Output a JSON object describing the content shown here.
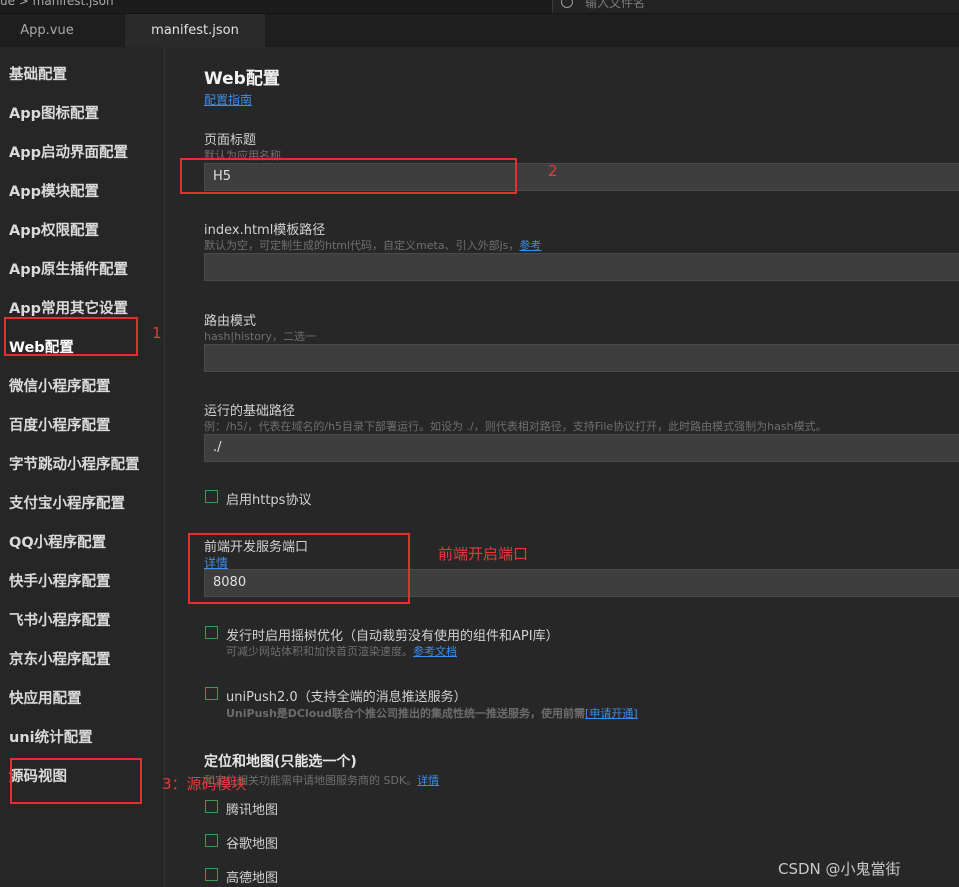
{
  "topbar": {
    "breadcrumb": "ue > manifest.json",
    "search_placeholder": "输入文件名"
  },
  "tabs": [
    {
      "label": "App.vue"
    },
    {
      "label": "manifest.json"
    }
  ],
  "sidebar": {
    "items": [
      {
        "label": "基础配置"
      },
      {
        "label": "App图标配置"
      },
      {
        "label": "App启动界面配置"
      },
      {
        "label": "App模块配置"
      },
      {
        "label": "App权限配置"
      },
      {
        "label": "App原生插件配置"
      },
      {
        "label": "App常用其它设置"
      },
      {
        "label": "Web配置"
      },
      {
        "label": "微信小程序配置"
      },
      {
        "label": "百度小程序配置"
      },
      {
        "label": "字节跳动小程序配置"
      },
      {
        "label": "支付宝小程序配置"
      },
      {
        "label": "QQ小程序配置"
      },
      {
        "label": "快手小程序配置"
      },
      {
        "label": "飞书小程序配置"
      },
      {
        "label": "京东小程序配置"
      },
      {
        "label": "快应用配置"
      },
      {
        "label": "uni统计配置"
      },
      {
        "label": "源码视图"
      }
    ]
  },
  "main": {
    "title": "Web配置",
    "guide_link": "配置指南",
    "page_title": {
      "label": "页面标题",
      "hint": "默认为应用名称",
      "value": "H5"
    },
    "template_path": {
      "label": "index.html模板路径",
      "hint": "默认为空，可定制生成的html代码，自定义meta、引入外部js，",
      "hint_link": "参考",
      "value": ""
    },
    "router_mode": {
      "label": "路由模式",
      "hint": "hash|history，二选一",
      "value": ""
    },
    "base_path": {
      "label": "运行的基础路径",
      "hint": "例：/h5/，代表在域名的/h5目录下部署运行。如设为 ./，则代表相对路径，支持File协议打开，此时路由模式强制为hash模式。",
      "value": "./"
    },
    "https": {
      "label": "启用https协议"
    },
    "dev_port": {
      "label": "前端开发服务端口",
      "link": "详情",
      "value": "8080"
    },
    "treeshake": {
      "label": "发行时启用摇树优化（自动裁剪没有使用的组件和API库）",
      "hint": "可减少网站体积和加快首页渲染速度。",
      "hint_link": "参考文档"
    },
    "unipush": {
      "label": "uniPush2.0（支持全端的消息推送服务）",
      "hint": "UniPush是DCloud联合个推公司推出的集成性统一推送服务，使用前需",
      "hint_link": "[申请开通]"
    },
    "maps": {
      "title": "定位和地图(只能选一个)",
      "hint": "和定位相关功能需申请地图服务商的 SDK。",
      "hint_link": "详情",
      "options": [
        {
          "label": "腾讯地图"
        },
        {
          "label": "谷歌地图"
        },
        {
          "label": "高德地图"
        }
      ]
    }
  },
  "annotations": {
    "n1": "1",
    "n2": "2",
    "port_note": "前端开启端口",
    "n3": "3：源码模块"
  },
  "watermark": "CSDN @小鬼當街"
}
